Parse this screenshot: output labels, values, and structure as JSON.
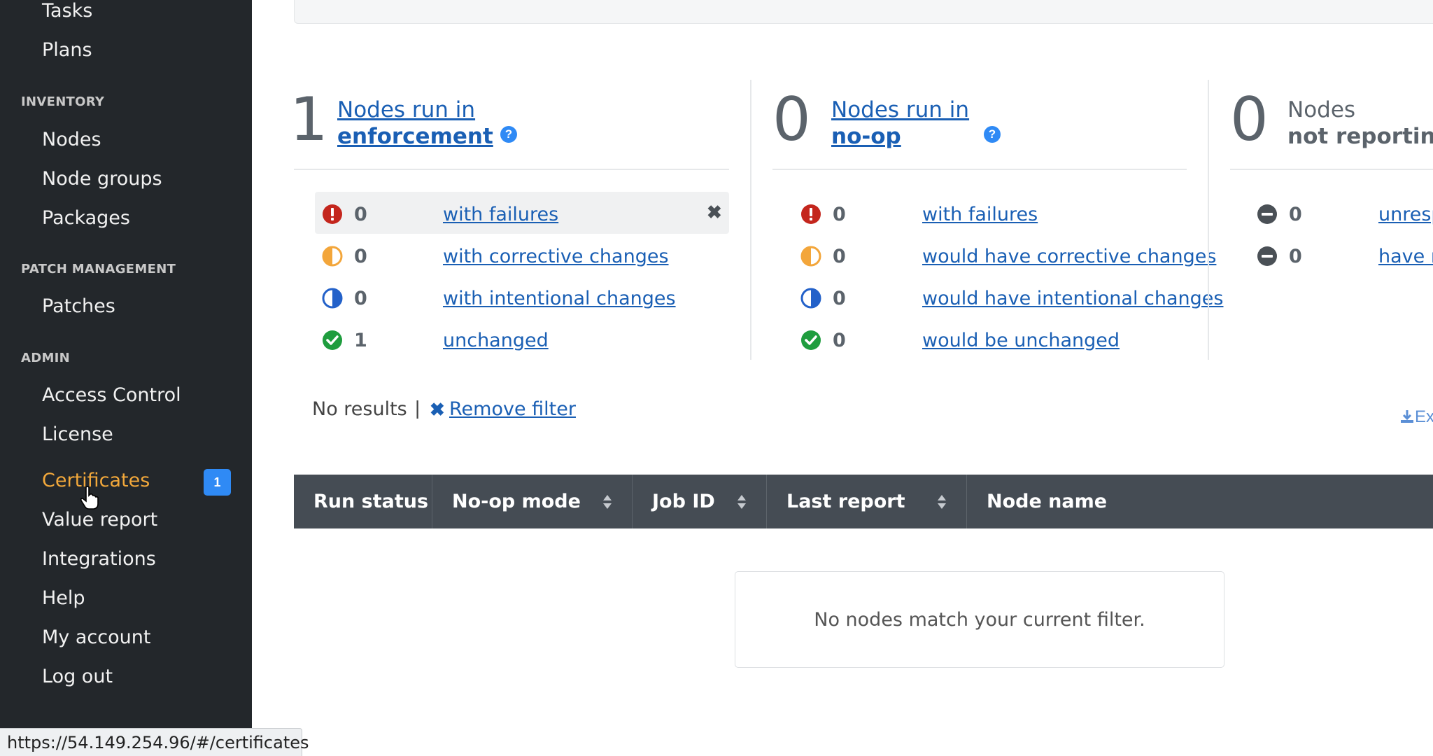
{
  "sidebar": {
    "items_top": [
      "Tasks",
      "Plans"
    ],
    "sections": [
      {
        "title": "INVENTORY",
        "items": [
          "Nodes",
          "Node groups",
          "Packages"
        ]
      },
      {
        "title": "PATCH MANAGEMENT",
        "items": [
          "Patches"
        ]
      },
      {
        "title": "ADMIN",
        "items": [
          "Access Control",
          "License",
          "Certificates",
          "Value report",
          "Integrations",
          "Help",
          "My account",
          "Log out"
        ]
      }
    ],
    "certificates_badge": "1"
  },
  "status_url": "https://54.149.254.96/#/certificates",
  "summary": {
    "enforcement": {
      "count": "1",
      "title_line1": "Nodes run in",
      "title_line2": "enforcement",
      "help": "?",
      "rows": [
        {
          "icon": "error-icon",
          "count": "0",
          "label": "with failures"
        },
        {
          "icon": "corrective-changes-icon",
          "count": "0",
          "label": "with corrective changes"
        },
        {
          "icon": "intentional-changes-icon",
          "count": "0",
          "label": "with intentional changes"
        },
        {
          "icon": "unchanged-check-icon",
          "count": "1",
          "label": "unchanged"
        }
      ],
      "close": "✖"
    },
    "noop": {
      "count": "0",
      "title_line1": "Nodes run in",
      "title_line2": "no-op",
      "help": "?",
      "rows": [
        {
          "icon": "error-icon",
          "count": "0",
          "label": "with failures"
        },
        {
          "icon": "corrective-changes-icon",
          "count": "0",
          "label": "would have corrective changes"
        },
        {
          "icon": "intentional-changes-icon",
          "count": "0",
          "label": "would have intentional changes"
        },
        {
          "icon": "unchanged-check-icon",
          "count": "0",
          "label": "would be unchanged"
        }
      ]
    },
    "not_reporting": {
      "count": "0",
      "title_line1": "Nodes",
      "title_line2": "not reporting",
      "rows": [
        {
          "icon": "minus-circle-icon",
          "count": "0",
          "label": "unresp"
        },
        {
          "icon": "minus-circle-icon",
          "count": "0",
          "label": "have n"
        }
      ]
    }
  },
  "filter": {
    "no_results": "No results",
    "separator": "|",
    "remove_icon": "✖",
    "remove_label": "Remove filter",
    "export_label": "Ex"
  },
  "table": {
    "columns": [
      "Run status",
      "No-op mode",
      "Job ID",
      "Last report",
      "Node name"
    ],
    "empty_message": "No nodes match your current filter."
  },
  "colors": {
    "sidebar_bg": "#23272b",
    "active_nav": "#f2a83b",
    "badge": "#2f8af5",
    "link": "#1a5fb4",
    "error": "#c4261d",
    "warning": "#f3a63b",
    "intentional": "#2361c9",
    "success": "#1f9d3e",
    "table_header": "#454c54"
  }
}
